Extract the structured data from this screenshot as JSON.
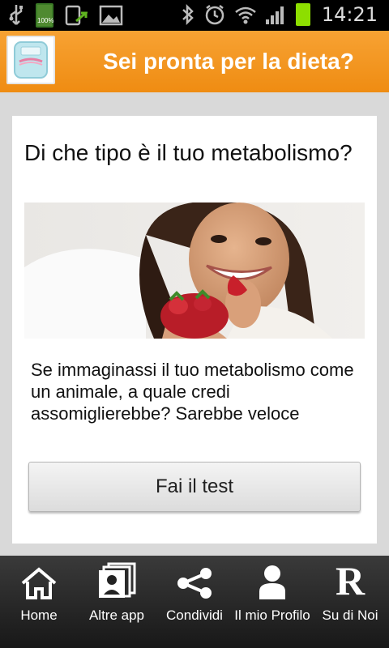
{
  "status_bar": {
    "time": "14:21",
    "battery_small_label": "100%"
  },
  "app": {
    "title": "Sei pronta per la dieta?"
  },
  "card": {
    "title": "Di che tipo è il tuo metabolismo?",
    "description": "Se immaginassi il tuo metabolismo come un animale, a quale credi assomiglierebbe? Sarebbe veloce",
    "button_label": "Fai il test"
  },
  "nav": {
    "items": [
      {
        "label": "Home",
        "icon": "home-icon"
      },
      {
        "label": "Altre app",
        "icon": "apps-icon"
      },
      {
        "label": "Condividi",
        "icon": "share-icon"
      },
      {
        "label": "Il mio Profilo",
        "icon": "profile-icon"
      },
      {
        "label": "Su di Noi",
        "icon": "about-icon",
        "glyph": "R"
      }
    ]
  },
  "colors": {
    "header_orange": "#f39a24",
    "nav_background": "#2a2a2a",
    "page_background": "#d9d9d9"
  }
}
